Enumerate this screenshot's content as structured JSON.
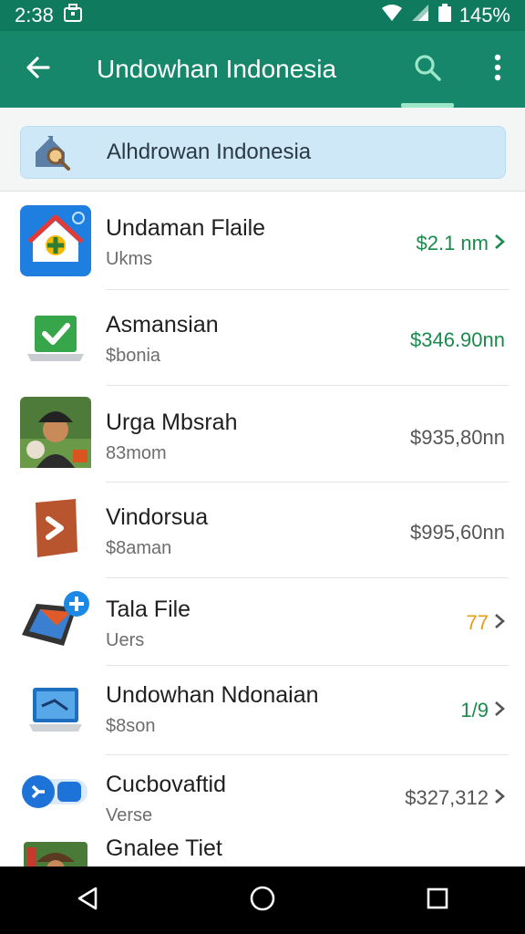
{
  "status_bar": {
    "time": "2:38",
    "battery": "145%",
    "icons": [
      "briefcase-icon",
      "wifi-icon",
      "signal-icon",
      "battery-icon"
    ]
  },
  "app_bar": {
    "title": "Undowhan Indonesia",
    "icons": [
      "back-arrow-icon",
      "search-icon",
      "more-vert-icon"
    ]
  },
  "search": {
    "value": "Alhdrowan Indonesia"
  },
  "items": [
    {
      "name": "Undaman Flaile",
      "sub": "Ukms",
      "price": "$2.1 nm",
      "price_color": "#1a8a4c",
      "chevron": true,
      "icon": "home-app-icon"
    },
    {
      "name": "Asmansian",
      "sub": "$bonia",
      "price": "$346.90nn",
      "price_color": "#1a8a4c",
      "chevron": false,
      "icon": "laptop-check-icon"
    },
    {
      "name": "Urga Mbsrah",
      "sub": "83mom",
      "price": "$935,80nn",
      "price_color": "#555555",
      "chevron": false,
      "icon": "portrait-photo-icon"
    },
    {
      "name": "Vindorsua",
      "sub": "$8aman",
      "price": "$995,60nn",
      "price_color": "#555555",
      "chevron": false,
      "icon": "orange-document-icon"
    },
    {
      "name": "Tala File",
      "sub": "Uers",
      "price": "77",
      "price_color": "#e59b15",
      "chevron": true,
      "icon": "tablet-plus-icon"
    },
    {
      "name": "Undowhan Ndonaian",
      "sub": "$8son",
      "price": "1/9",
      "price_color": "#1a8a4c",
      "chevron": true,
      "icon": "monitor-icon"
    },
    {
      "name": "Cucbovaftid",
      "sub": "Verse",
      "price": "$327,312",
      "price_color": "#555555",
      "chevron": true,
      "icon": "blue-badge-icon"
    },
    {
      "name": "Gnalee Tiet",
      "sub": "",
      "price": "",
      "price_color": "#1a8a4c",
      "chevron": false,
      "icon": "portrait-photo-icon"
    }
  ],
  "nav_bar": {
    "icons": [
      "nav-back-icon",
      "nav-home-icon",
      "nav-recents-icon"
    ]
  }
}
